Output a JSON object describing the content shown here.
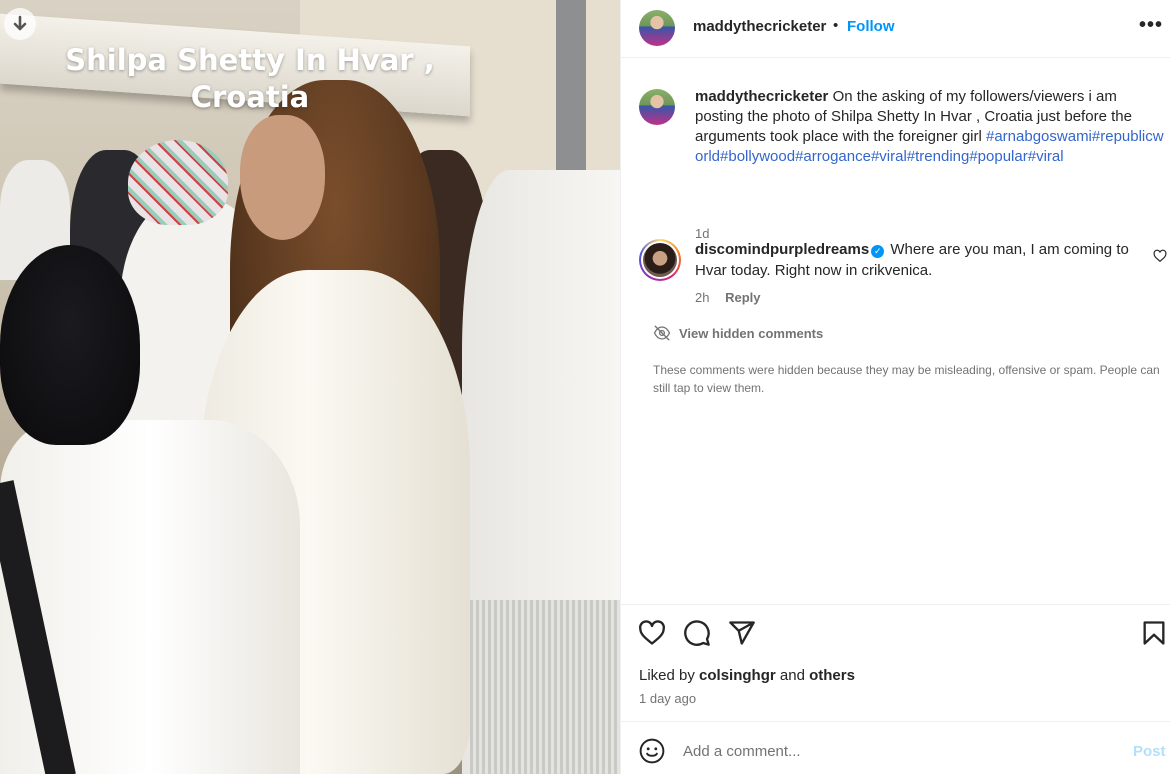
{
  "photo": {
    "caption_line1": "Shilpa Shetty In Hvar ,",
    "caption_line2": "Croatia"
  },
  "header": {
    "username": "maddythecricketer",
    "separator": "•",
    "follow_label": "Follow",
    "more_label": "•••"
  },
  "caption": {
    "username": "maddythecricketer",
    "text": "On the asking of my followers/viewers i am posting the photo of Shilpa Shetty In Hvar , Croatia just before the arguments took place with the foreigner girl",
    "hashtags": "#arnabgoswami#republicworld#bollywood#arrogance#viral#trending#popular#viral",
    "time": "1d"
  },
  "comment": {
    "username": "discomindpurpledreams",
    "verified_icon": "✓",
    "text": "Where are you man, I am coming to Hvar today. Right now in crikvenica.",
    "time": "2h",
    "reply_label": "Reply"
  },
  "hidden_comments": {
    "label": "View hidden comments",
    "note": "These comments were hidden because they may be misleading, offensive or spam. People can still tap to view them."
  },
  "actions": {
    "icons": [
      "heart-icon",
      "comment-icon",
      "share-icon",
      "bookmark-icon"
    ],
    "liked_prefix": "Liked by",
    "liked_user": "colsinghgr",
    "liked_and": "and",
    "liked_others": "others",
    "time_ago": "1 day ago"
  },
  "add_comment": {
    "placeholder": "Add a comment...",
    "post_label": "Post"
  },
  "colors": {
    "accent": "#0095f6",
    "hashtag": "#3366cc",
    "muted": "#737373",
    "post_disabled": "#b2dffc"
  }
}
